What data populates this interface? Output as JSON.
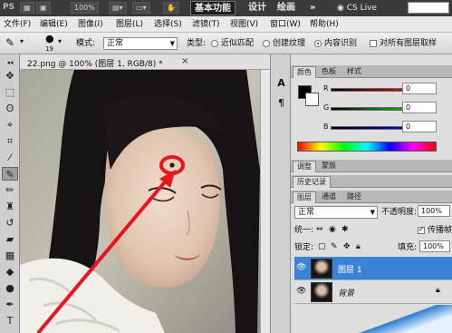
{
  "topbar": {
    "logo": "PS",
    "zoom": "100%",
    "workspaces": [
      "基本功能",
      "设计",
      "绘画"
    ],
    "more": "»",
    "cs_live": "CS Live"
  },
  "menu": [
    "文件(F)",
    "编辑(E)",
    "图像(I)",
    "图层(L)",
    "选择(S)",
    "滤镜(T)",
    "视图(V)",
    "窗口(W)",
    "帮助(H)"
  ],
  "options": {
    "brush_size": "19",
    "mode_label": "模式:",
    "mode_value": "正常",
    "type_label": "类型:",
    "type_options": [
      "近似匹配",
      "创建纹理",
      "内容识别"
    ],
    "type_selected": "内容识别",
    "sample_all": "对所有图层取样"
  },
  "document": {
    "title": "22.png @ 100% (图层 1, RGB/8) *",
    "close": "×"
  },
  "color_panel": {
    "tabs": [
      "颜色",
      "色板",
      "样式"
    ],
    "sliders": [
      {
        "label": "R",
        "value": "0"
      },
      {
        "label": "G",
        "value": "0"
      },
      {
        "label": "B",
        "value": "0"
      }
    ]
  },
  "adjust_tabs": [
    "调整",
    "蒙版"
  ],
  "history_tab": "历史记录",
  "layers_panel": {
    "tabs": [
      "图层",
      "通道",
      "路径"
    ],
    "blend_mode": "正常",
    "opacity_label": "不透明度:",
    "opacity": "100%",
    "unify_label": "统一:",
    "propagate": "传播帧",
    "lock_label": "锁定:",
    "fill_label": "填充:",
    "fill": "100%",
    "layers": [
      {
        "name": "图层 1",
        "selected": true
      },
      {
        "name": "背景",
        "selected": false
      }
    ]
  },
  "colors": {
    "accent_selected": "#3b83d6",
    "annotation": "#e8141e"
  }
}
